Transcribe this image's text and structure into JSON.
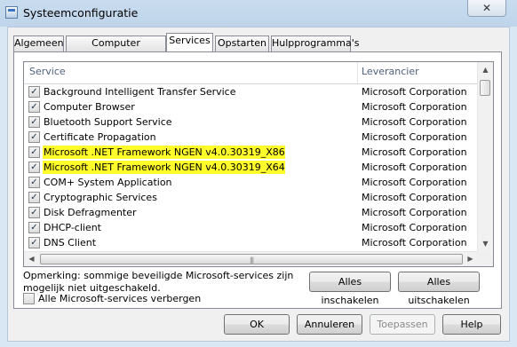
{
  "window": {
    "title": "Systeemconfiguratie",
    "close_glyph": "✕"
  },
  "tabs": [
    {
      "label": "Algemeen"
    },
    {
      "label": "Computer opstarten"
    },
    {
      "label": "Services"
    },
    {
      "label": "Opstarten"
    },
    {
      "label": "Hulpprogramma's"
    }
  ],
  "list": {
    "headers": {
      "service": "Service",
      "vendor": "Leverancier"
    },
    "rows": [
      {
        "service": "Background Intelligent Transfer Service",
        "vendor": "Microsoft Corporation",
        "checked": true
      },
      {
        "service": "Computer Browser",
        "vendor": "Microsoft Corporation",
        "checked": true
      },
      {
        "service": "Bluetooth Support Service",
        "vendor": "Microsoft Corporation",
        "checked": true
      },
      {
        "service": "Certificate Propagation",
        "vendor": "Microsoft Corporation",
        "checked": true
      },
      {
        "service": "Microsoft .NET Framework NGEN v4.0.30319_X86",
        "vendor": "Microsoft Corporation",
        "checked": true,
        "highlighted": true
      },
      {
        "service": "Microsoft .NET Framework NGEN v4.0.30319_X64",
        "vendor": "Microsoft Corporation",
        "checked": true,
        "highlighted": true
      },
      {
        "service": "COM+ System Application",
        "vendor": "Microsoft Corporation",
        "checked": true
      },
      {
        "service": "Cryptographic Services",
        "vendor": "Microsoft Corporation",
        "checked": true
      },
      {
        "service": "Disk Defragmenter",
        "vendor": "Microsoft Corporation",
        "checked": true
      },
      {
        "service": "DHCP-client",
        "vendor": "Microsoft Corporation",
        "checked": true
      },
      {
        "service": "DNS Client",
        "vendor": "Microsoft Corporation",
        "checked": true
      }
    ],
    "check_glyph": "✓",
    "highlight_color": "#fffc2b"
  },
  "note": "Opmerking: sommige beveiligde Microsoft-services zijn mogelijk niet uitgeschakeld.",
  "buttons": {
    "enable_all": "Alles inschakelen",
    "disable_all": "Alles uitschakelen",
    "ok": "OK",
    "cancel": "Annuleren",
    "apply": "Toepassen",
    "help": "Help"
  },
  "hide_ms": {
    "label": "Alle Microsoft-services verbergen",
    "checked": false
  }
}
